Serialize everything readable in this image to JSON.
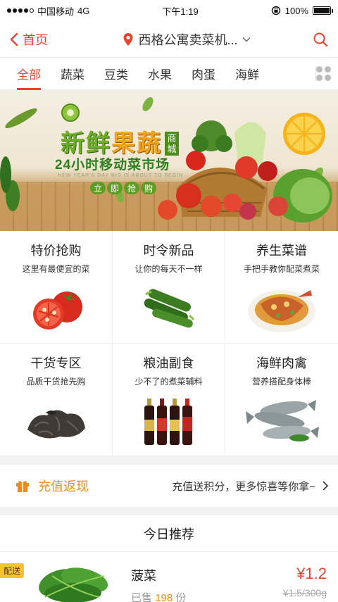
{
  "status_bar": {
    "carrier": "中国移动",
    "network": "4G",
    "time": "下午1:19",
    "battery": "100%"
  },
  "nav": {
    "back_label": "首页",
    "location": "西格公寓卖菜机..."
  },
  "tabs": [
    {
      "label": "全部",
      "active": true
    },
    {
      "label": "蔬菜",
      "active": false
    },
    {
      "label": "豆类",
      "active": false
    },
    {
      "label": "水果",
      "active": false
    },
    {
      "label": "肉蛋",
      "active": false
    },
    {
      "label": "海鲜",
      "active": false
    }
  ],
  "banner": {
    "title_a": "新鲜",
    "title_b": "果蔬",
    "title_side": "商城",
    "subtitle": "24小时移动菜市场",
    "english": "NEW YEAR'S DAY BIG IS ABOUT TO BEGIN",
    "button_chars": [
      "立",
      "即",
      "抢",
      "购"
    ]
  },
  "categories": [
    {
      "title": "特价抢购",
      "subtitle": "这里有最便宜的菜",
      "icon": "tomato-icon"
    },
    {
      "title": "时令新品",
      "subtitle": "让你的每天不一样",
      "icon": "cucumber-icon"
    },
    {
      "title": "养生菜谱",
      "subtitle": "手把手教你配菜煮菜",
      "icon": "dish-icon"
    },
    {
      "title": "干货专区",
      "subtitle": "品质干货抢先购",
      "icon": "dried-fungus-icon"
    },
    {
      "title": "粮油副食",
      "subtitle": "少不了的煮菜辅料",
      "icon": "sauce-bottles-icon"
    },
    {
      "title": "海鲜肉禽",
      "subtitle": "营养搭配身体棒",
      "icon": "fish-icon"
    }
  ],
  "promo": {
    "label": "充值返现",
    "detail": "充值送积分，更多惊喜等你拿~"
  },
  "section": {
    "title": "今日推荐"
  },
  "product": {
    "badge": "配送",
    "name": "菠菜",
    "sold_prefix": "已售",
    "sold_count": "198",
    "sold_unit": "份",
    "price": "¥1.2",
    "original": "¥1.5/300g"
  },
  "colors": {
    "accent": "#e8452d",
    "promo": "#f08a1c",
    "badge": "#f8c32c"
  }
}
